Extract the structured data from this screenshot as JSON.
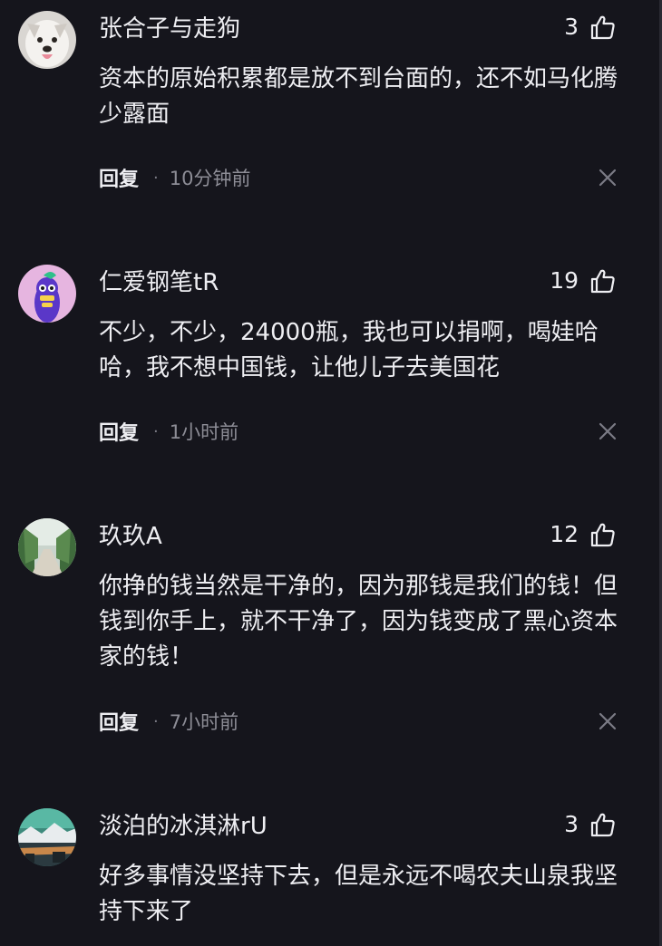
{
  "comments": [
    {
      "username": "张合子与走狗",
      "likes": "3",
      "text": "资本的原始积累都是放不到台面的，还不如马化腾少露面",
      "reply_label": "回复",
      "separator": "·",
      "time": "10分钟前",
      "avatar_icon": "dog-avatar"
    },
    {
      "username": "仁爱钢笔tR",
      "likes": "19",
      "text": "不少，不少，24000瓶，我也可以捐啊，喝娃哈哈，我不想中国钱，让他儿子去美国花",
      "reply_label": "回复",
      "separator": "·",
      "time": "1小时前",
      "avatar_icon": "cartoon-bird-avatar"
    },
    {
      "username": "玖玖A",
      "likes": "12",
      "text": "你挣的钱当然是干净的，因为那钱是我们的钱！但钱到你手上，就不干净了，因为钱变成了黑心资本家的钱！",
      "reply_label": "回复",
      "separator": "·",
      "time": "7小时前",
      "avatar_icon": "tree-road-avatar"
    },
    {
      "username": "淡泊的冰淇淋rU",
      "likes": "3",
      "text": "好多事情没坚持下去，但是永远不喝农夫山泉我坚持下来了",
      "reply_label": "",
      "separator": "",
      "time": "",
      "avatar_icon": "landscape-avatar"
    }
  ],
  "colors": {
    "background": "#15151c",
    "text": "#eeeef2",
    "secondary": "#8d8d96"
  }
}
